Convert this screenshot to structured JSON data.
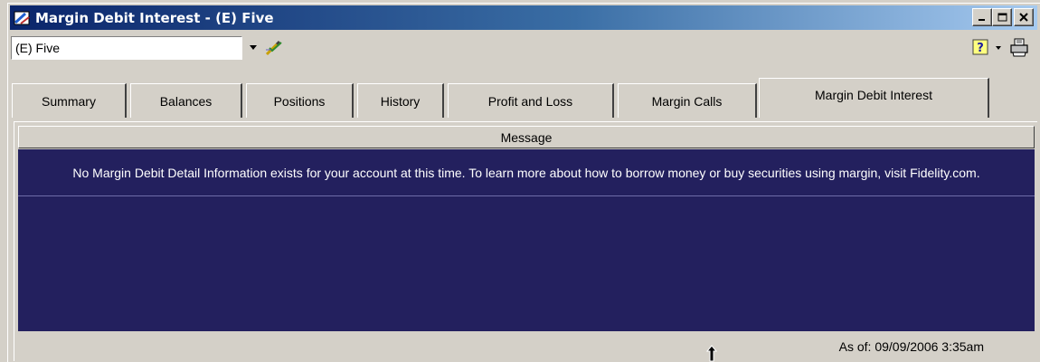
{
  "window": {
    "title": "Margin Debit Interest - (E) Five",
    "buttons": [
      "minimize",
      "maximize",
      "close"
    ]
  },
  "toolbar": {
    "account_value": "(E) Five",
    "tool_icon": "pencil-check-icon",
    "help_icon": "help-icon",
    "print_icon": "printer-icon"
  },
  "tabs": [
    {
      "label": "Summary",
      "active": false
    },
    {
      "label": "Balances",
      "active": false
    },
    {
      "label": "Positions",
      "active": false
    },
    {
      "label": "History",
      "active": false
    },
    {
      "label": "Profit and Loss",
      "active": false
    },
    {
      "label": "Margin Calls",
      "active": false
    },
    {
      "label": "Margin Debit Interest",
      "active": true
    }
  ],
  "grid": {
    "header": "Message",
    "message": "No Margin Debit Detail Information exists for your account at this time.  To learn more about how to borrow money or buy securities using margin, visit Fidelity.com."
  },
  "status": {
    "as_of": "As of: 09/09/2006  3:35am"
  },
  "colors": {
    "title_gradient_start": "#0a246a",
    "title_gradient_end": "#a6caf0",
    "grid_background": "#23205e",
    "window_face": "#d4d0c8"
  }
}
